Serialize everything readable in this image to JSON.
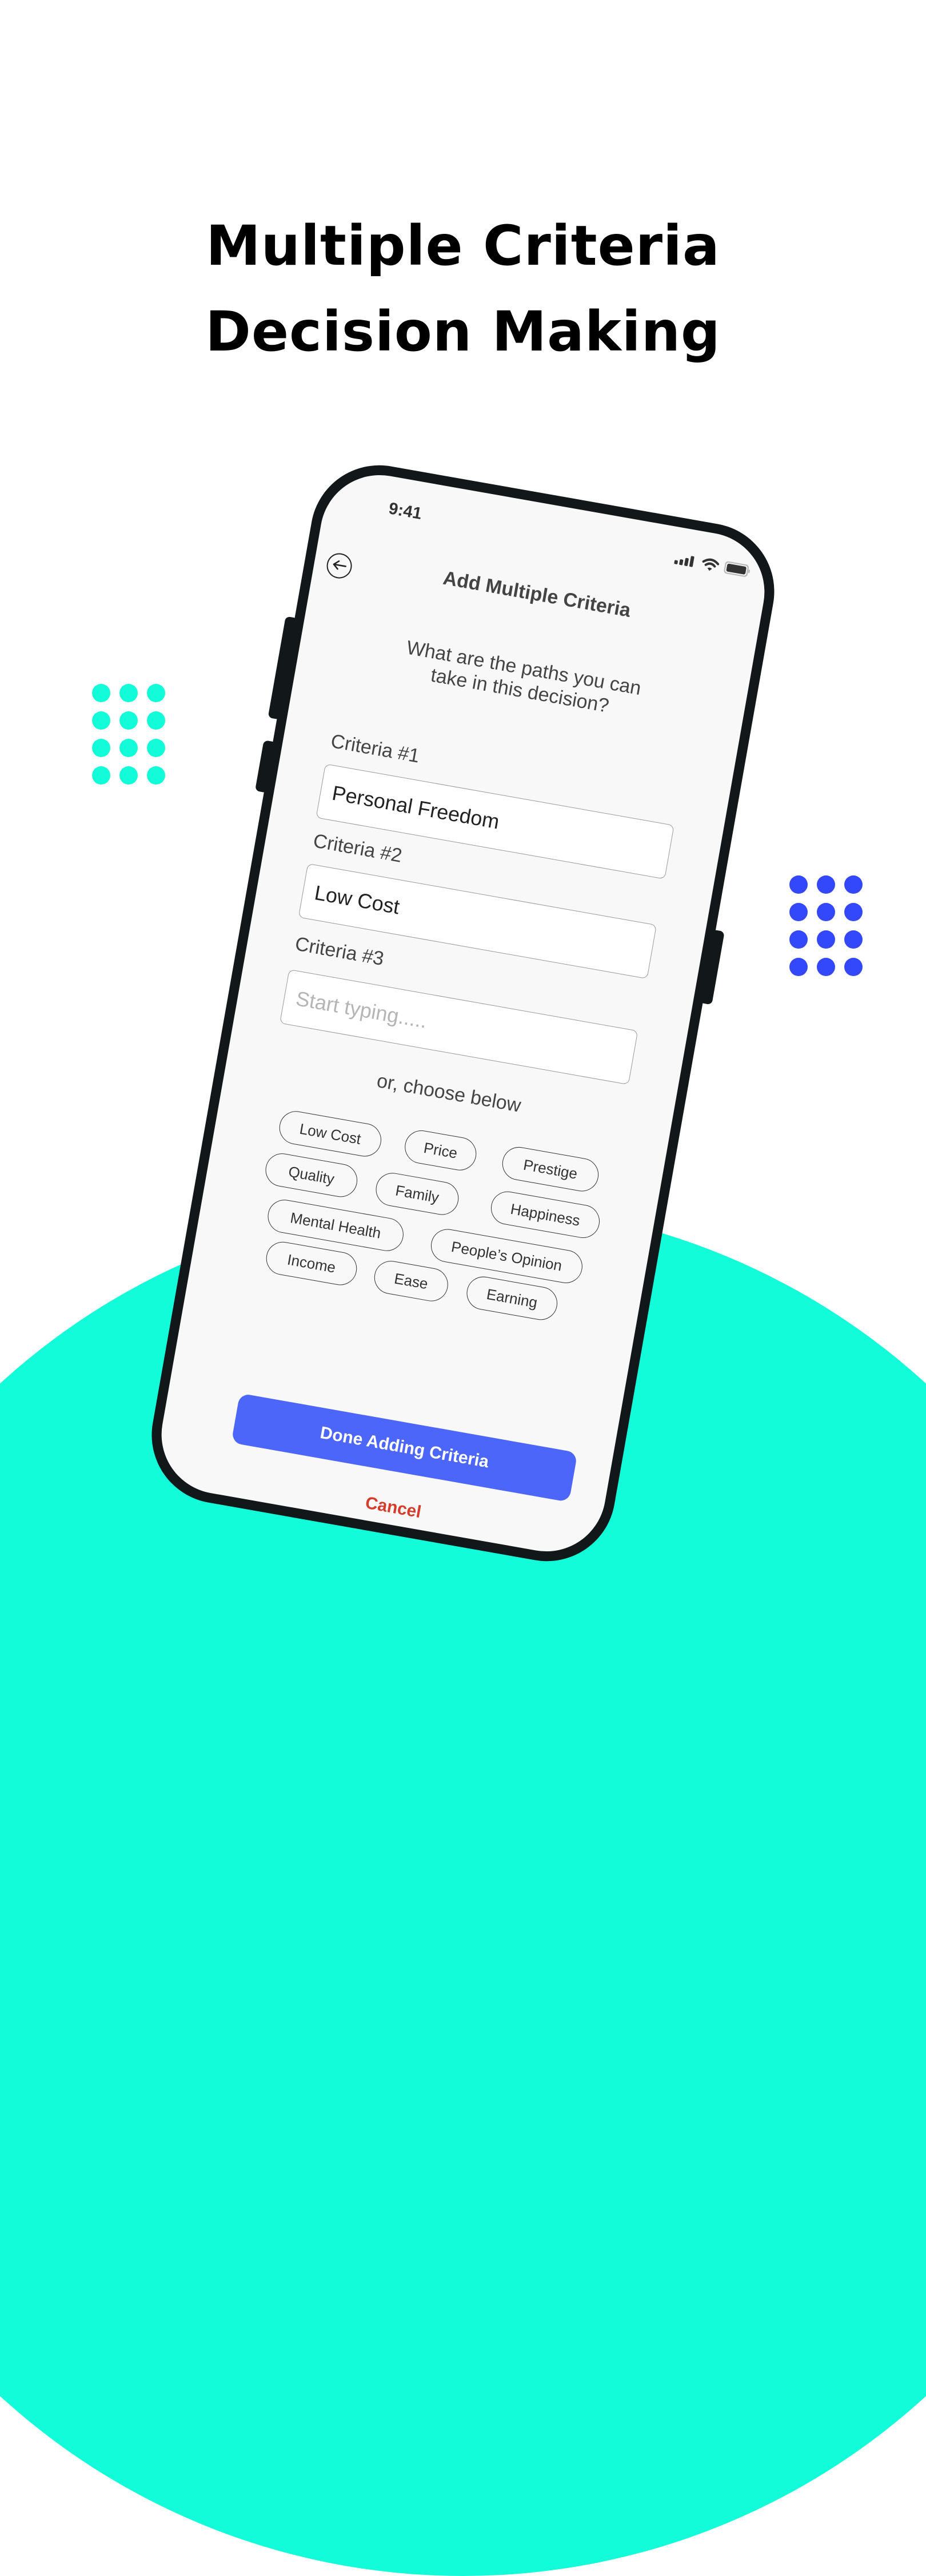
{
  "headline": {
    "line1": "Multiple Criteria",
    "line2": "Decision Making"
  },
  "colors": {
    "accent_teal": "#12fcd9",
    "accent_blue": "#3348fb",
    "button_primary": "#4d66fa",
    "cancel_red": "#d43c2c",
    "phone_frame": "#121819",
    "screen_bg": "#f8f8f8"
  },
  "status_bar": {
    "time": "9:41",
    "icons": [
      "signal-icon",
      "wifi-icon",
      "battery-icon"
    ]
  },
  "screen": {
    "back_icon": "arrow-left-icon",
    "title": "Add Multiple Criteria",
    "subtitle": "What are the paths you can take in this decision?",
    "fields": [
      {
        "label": "Criteria #1",
        "value": "Personal Freedom",
        "placeholder": ""
      },
      {
        "label": "Criteria #2",
        "value": "Low Cost",
        "placeholder": ""
      },
      {
        "label": "Criteria #3",
        "value": "",
        "placeholder": "Start typing....."
      }
    ],
    "or_text": "or, choose below",
    "chips": [
      "Low Cost",
      "Price",
      "Prestige",
      "Quality",
      "Family",
      "Happiness",
      "Mental Health",
      "People’s Opinion",
      "Income",
      "Ease",
      "Earning"
    ],
    "done_button": "Done Adding Criteria",
    "cancel_button": "Cancel"
  }
}
